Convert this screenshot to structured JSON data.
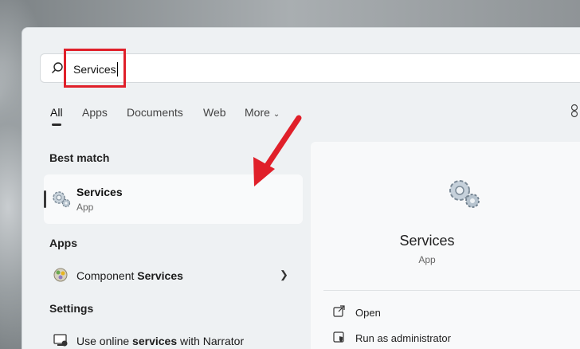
{
  "search": {
    "query": "Services"
  },
  "tabs": [
    {
      "label": "All"
    },
    {
      "label": "Apps"
    },
    {
      "label": "Documents"
    },
    {
      "label": "Web"
    },
    {
      "label": "More"
    }
  ],
  "best_match": {
    "heading": "Best match",
    "title": "Services",
    "subtitle": "App"
  },
  "apps": {
    "heading": "Apps",
    "items": [
      {
        "prefix": "Component ",
        "bold": "Services"
      }
    ]
  },
  "settings": {
    "heading": "Settings",
    "items": [
      {
        "prefix": "Use online ",
        "bold": "services",
        "suffix": " with Narrator"
      }
    ]
  },
  "detail": {
    "title": "Services",
    "subtitle": "App",
    "actions": [
      {
        "label": "Open"
      },
      {
        "label": "Run as administrator"
      }
    ]
  },
  "colors": {
    "highlight": "#e0202a",
    "accent": "#2b2b2b"
  }
}
